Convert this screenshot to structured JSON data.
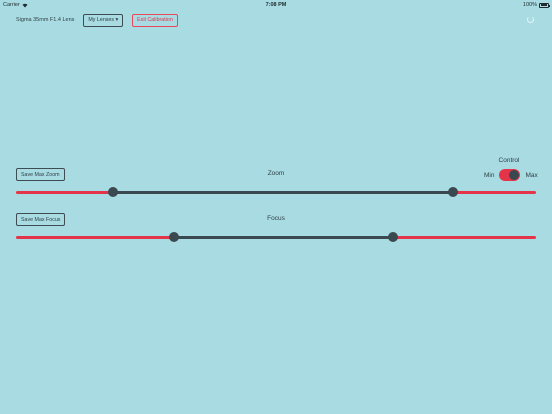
{
  "status_bar": {
    "carrier": "Carrier",
    "time": "7:08 PM",
    "battery": "100%"
  },
  "header": {
    "lens_name": "Sigma 35mm F1.4 Lens",
    "lens_menu_label": "My Lenses ▾",
    "exit_label": "Exit Calibration"
  },
  "zoom": {
    "save_label": "Save Max Zoom",
    "title": "Zoom",
    "range_fraction": [
      0.186,
      0.837
    ]
  },
  "focus": {
    "save_label": "Save Max Focus",
    "title": "Focus",
    "range_fraction": [
      0.305,
      0.725
    ]
  },
  "control": {
    "title": "Control",
    "min_label": "Min",
    "max_label": "Max",
    "selected": "Max"
  },
  "colors": {
    "background": "#a8dbe2",
    "accent": "#e4344a",
    "slider_fill": "#39494f"
  }
}
